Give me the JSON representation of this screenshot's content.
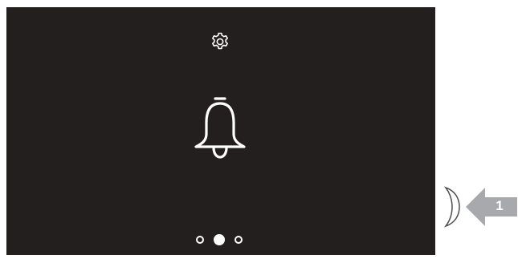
{
  "screen": {
    "background": "#231f1f",
    "foreground": "#ffffff",
    "top_icon": "gear-icon",
    "center_icon": "bell-icon",
    "pager": {
      "total": 3,
      "active_index": 1
    }
  },
  "callout": {
    "label": "1",
    "color": "#a7a9ac",
    "pointer_icon": "arrow-left-icon"
  },
  "hardware": {
    "side_button_icon": "side-button"
  }
}
